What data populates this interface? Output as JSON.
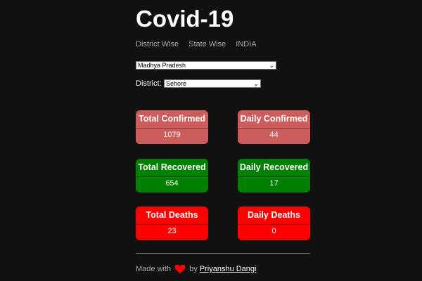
{
  "header": {
    "title": "Covid-19"
  },
  "nav": {
    "items": [
      "District Wise",
      "State Wise",
      "INDIA"
    ]
  },
  "selectors": {
    "state_value": "Madhya Pradesh",
    "district_label": "District:",
    "district_value": "Sehore"
  },
  "stats": {
    "total_confirmed": {
      "label": "Total Confirmed",
      "value": "1079"
    },
    "daily_confirmed": {
      "label": "Daily Confirmed",
      "value": "44"
    },
    "total_recovered": {
      "label": "Total Recovered",
      "value": "654"
    },
    "daily_recovered": {
      "label": "Daily Recovered",
      "value": "17"
    },
    "total_deaths": {
      "label": "Total Deaths",
      "value": "23"
    },
    "daily_deaths": {
      "label": "Daily Deaths",
      "value": "0"
    }
  },
  "colors": {
    "background": "#111111",
    "confirmed": "#cd5c5c",
    "recovered": "#008000",
    "deaths": "#ff0000",
    "heart": "#ff0000"
  },
  "footer": {
    "made_with": "Made with",
    "by": "by",
    "author": "Priyanshu Dangi"
  },
  "icons": {
    "dropdown": "chevron-down-icon",
    "heart": "heart-icon"
  }
}
